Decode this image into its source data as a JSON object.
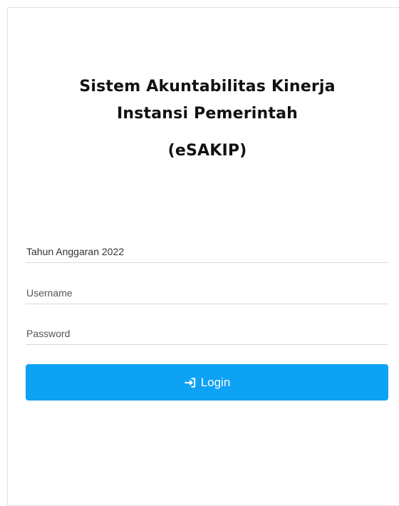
{
  "header": {
    "title_line1": "Sistem Akuntabilitas Kinerja",
    "title_line2": "Instansi Pemerintah",
    "title_line3": "(eSAKIP)"
  },
  "form": {
    "year_value": "Tahun Anggaran 2022",
    "username_placeholder": "Username",
    "password_placeholder": "Password",
    "login_label": "Login",
    "login_icon": "sign-in-icon"
  },
  "colors": {
    "accent": "#0ea2f5",
    "text": "#111111"
  }
}
